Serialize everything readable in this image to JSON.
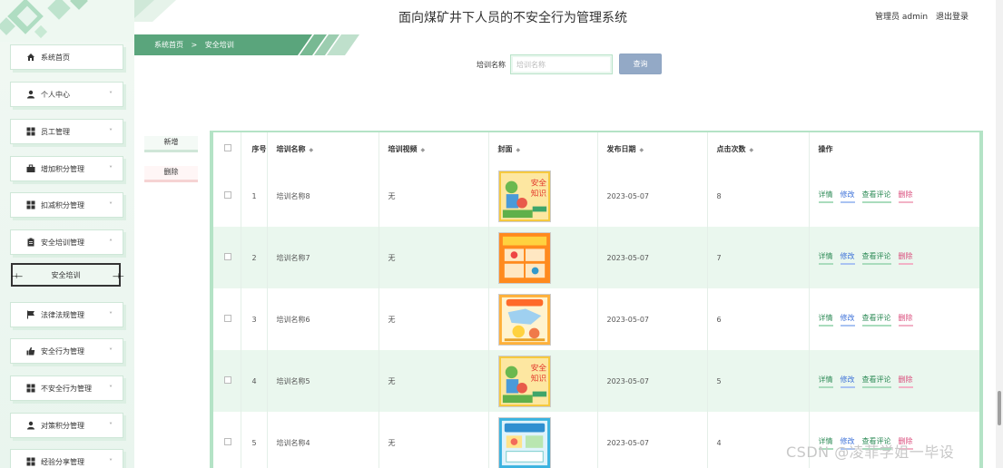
{
  "header": {
    "title": "面向煤矿井下人员的不安全行为管理系统",
    "admin_label": "管理员 admin",
    "logout_label": "退出登录"
  },
  "breadcrumb": {
    "home": "系统首页",
    "separator": ">",
    "current": "安全培训"
  },
  "sidebar": {
    "items": [
      {
        "label": "系统首页",
        "icon": "home-icon",
        "chevron": ""
      },
      {
        "label": "个人中心",
        "icon": "user-icon",
        "chevron": "˅"
      },
      {
        "label": "员工管理",
        "icon": "grid-icon",
        "chevron": "˅"
      },
      {
        "label": "增加积分管理",
        "icon": "briefcase-icon",
        "chevron": "˅"
      },
      {
        "label": "扣减积分管理",
        "icon": "grid-icon",
        "chevron": "˅"
      },
      {
        "label": "安全培训管理",
        "icon": "clipboard-icon",
        "chevron": "˄"
      },
      {
        "label": "法律法规管理",
        "icon": "flag-icon",
        "chevron": "˅"
      },
      {
        "label": "安全行为管理",
        "icon": "thumbsup-icon",
        "chevron": "˅"
      },
      {
        "label": "不安全行为管理",
        "icon": "grid-icon",
        "chevron": "˅"
      },
      {
        "label": "对策积分管理",
        "icon": "user-icon",
        "chevron": "˅"
      },
      {
        "label": "经验分享管理",
        "icon": "grid-icon",
        "chevron": "˅"
      }
    ],
    "submenu": {
      "label": "安全培训"
    }
  },
  "search": {
    "label": "培训名称",
    "placeholder": "培训名称",
    "value": "",
    "button": "查询"
  },
  "actions": {
    "add": "新增",
    "delete": "删除"
  },
  "table": {
    "headers": {
      "index": "序号",
      "name": "培训名称",
      "video": "培训视频",
      "cover": "封面",
      "date": "发布日期",
      "clicks": "点击次数",
      "ops": "操作"
    },
    "op_labels": {
      "detail": "详情",
      "edit": "修改",
      "comment": "查看评论",
      "delete": "删除"
    },
    "rows": [
      {
        "index": "1",
        "name": "培训名称8",
        "video": "无",
        "cover": "poster-a",
        "date": "2023-05-07",
        "clicks": "8"
      },
      {
        "index": "2",
        "name": "培训名称7",
        "video": "无",
        "cover": "poster-b",
        "date": "2023-05-07",
        "clicks": "7"
      },
      {
        "index": "3",
        "name": "培训名称6",
        "video": "无",
        "cover": "poster-c",
        "date": "2023-05-07",
        "clicks": "6"
      },
      {
        "index": "4",
        "name": "培训名称5",
        "video": "无",
        "cover": "poster-a",
        "date": "2023-05-07",
        "clicks": "5"
      },
      {
        "index": "5",
        "name": "培训名称4",
        "video": "无",
        "cover": "poster-d",
        "date": "2023-05-07",
        "clicks": "4"
      }
    ]
  },
  "poster_text": {
    "safety": "安全",
    "knowledge": "知识"
  },
  "watermark": "CSDN @凌菲学姐一毕设",
  "colors": {
    "accent_green": "#5aa57c",
    "row_alt": "#eaf7ee",
    "search_button": "#93a9c6",
    "delete_pink": "#d94a7a",
    "edit_blue": "#3a6fd8"
  }
}
